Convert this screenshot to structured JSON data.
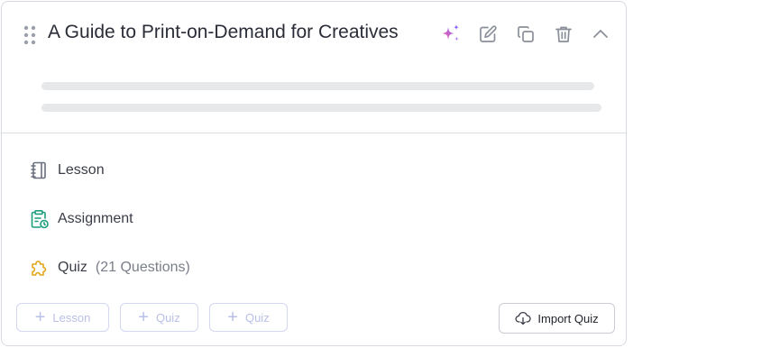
{
  "topic": {
    "title": "A Guide to Print-on-Demand for Creatives"
  },
  "header_actions": [
    {
      "icon": "sparkle-ai-icon"
    },
    {
      "icon": "edit-icon"
    },
    {
      "icon": "duplicate-icon"
    },
    {
      "icon": "trash-icon"
    },
    {
      "icon": "chevron-up-icon"
    }
  ],
  "items": [
    {
      "type": "lesson",
      "icon": "notebook-icon",
      "label": "Lesson",
      "meta": ""
    },
    {
      "type": "assignment",
      "icon": "clipboard-clock-icon",
      "label": "Assignment",
      "meta": ""
    },
    {
      "type": "quiz",
      "icon": "puzzle-icon",
      "label": "Quiz",
      "meta": "(21 Questions)"
    }
  ],
  "footer": {
    "add_lesson": "Lesson",
    "add_quiz_1": "Quiz",
    "add_quiz_2": "Quiz",
    "import_quiz": "Import Quiz"
  },
  "colors": {
    "assignment_icon": "#1a9e7b",
    "quiz_icon": "#e2a61b",
    "add_button_text": "#b9bfe6",
    "sparkle_pink": "#ff5f9e",
    "sparkle_purple": "#8a63f5"
  }
}
